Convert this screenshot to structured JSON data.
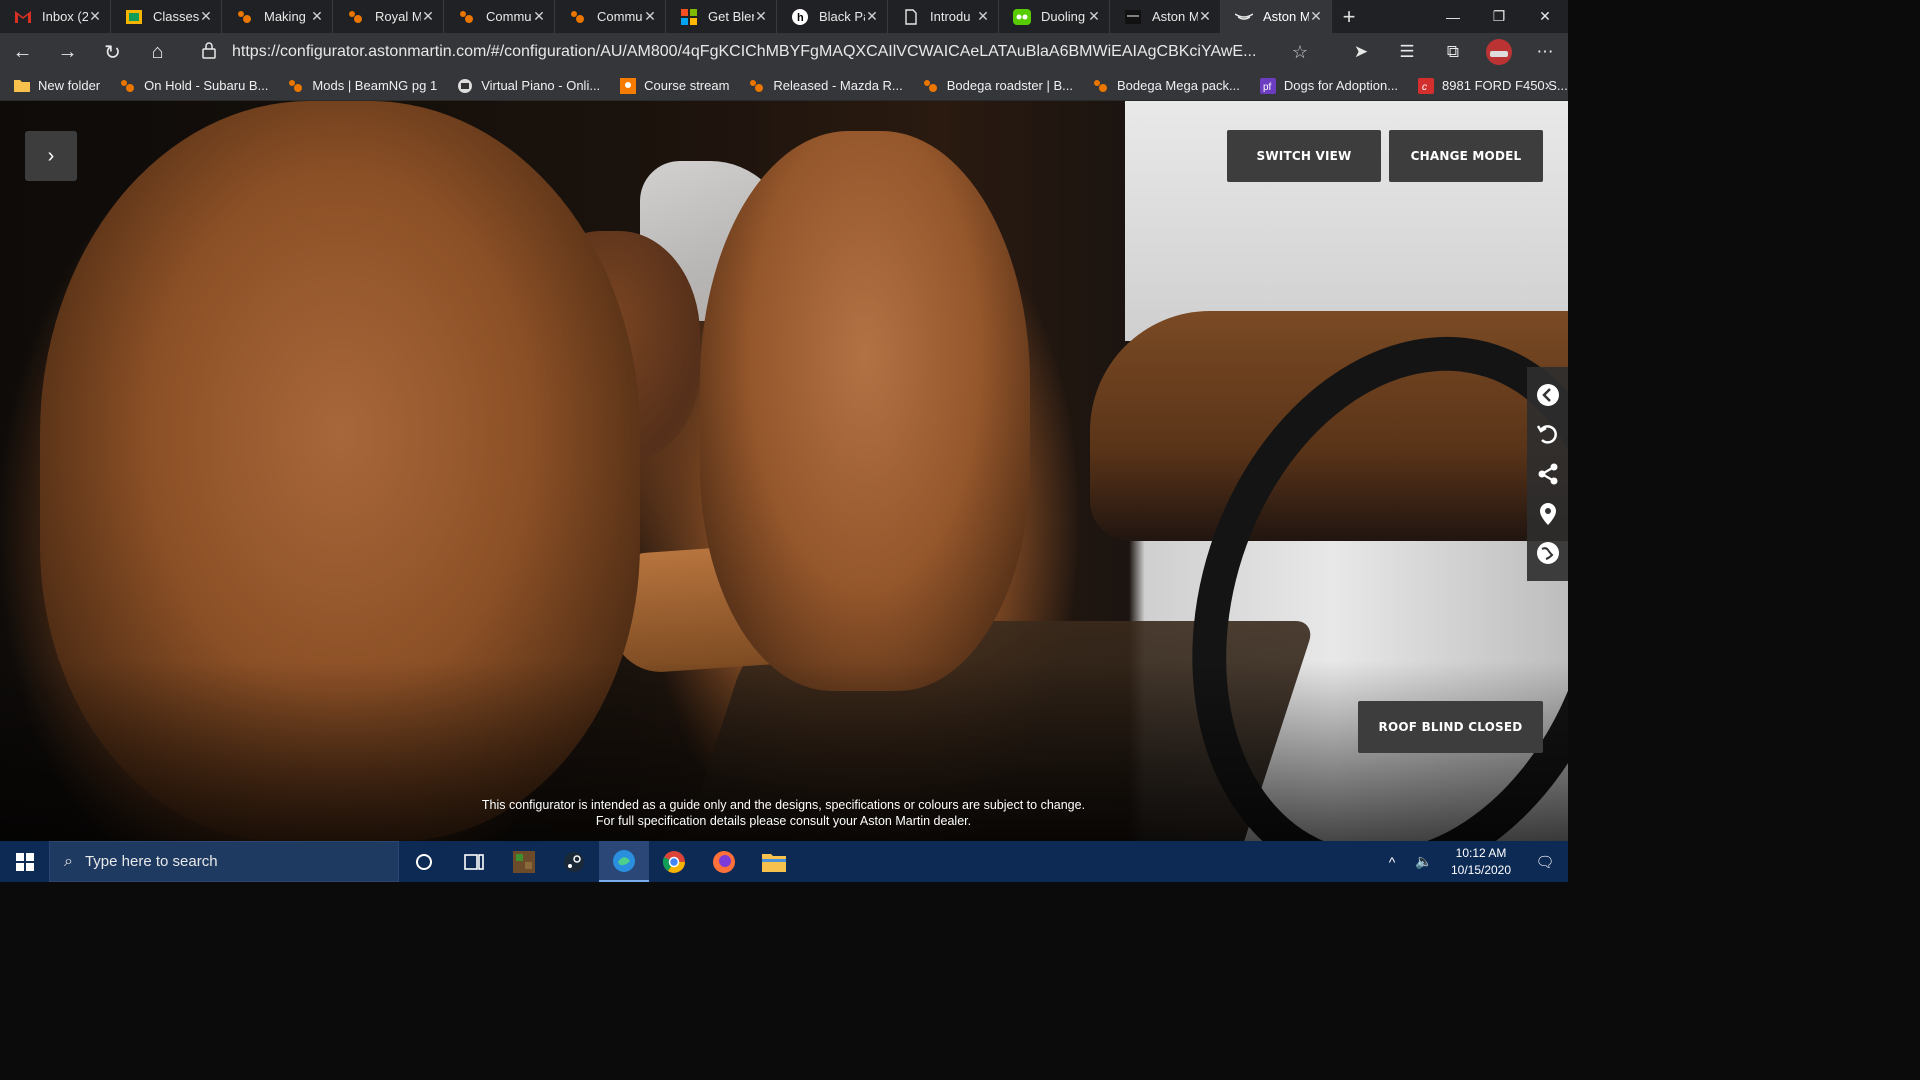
{
  "browser": {
    "tabs": [
      {
        "title": "Inbox (2",
        "icon": "gmail-icon",
        "color": "#d93025"
      },
      {
        "title": "Classes",
        "icon": "classroom-icon",
        "color": "#f4b400"
      },
      {
        "title": "Making",
        "icon": "blender-icon",
        "color": "#ea7600"
      },
      {
        "title": "Royal M",
        "icon": "blender-icon",
        "color": "#ea7600"
      },
      {
        "title": "Commu",
        "icon": "blender-icon",
        "color": "#ea7600"
      },
      {
        "title": "Commu",
        "icon": "blender-icon",
        "color": "#ea7600"
      },
      {
        "title": "Get Blen",
        "icon": "microsoft-icon",
        "color": "#00a4ef"
      },
      {
        "title": "Black Pa",
        "icon": "h-icon",
        "color": "#ffffff"
      },
      {
        "title": "Introdu",
        "icon": "document-icon",
        "color": "#e8e8e8"
      },
      {
        "title": "Duoling",
        "icon": "duolingo-icon",
        "color": "#58cc02"
      },
      {
        "title": "Aston M",
        "icon": "aston-martin-icon",
        "color": "#111111"
      },
      {
        "title": "Aston M",
        "icon": "aston-martin-icon",
        "color": "#ffffff",
        "active": true
      }
    ],
    "url": "https://configurator.astonmartin.com/#/configuration/AU/AM800/4qFgKCIChMBYFgMAQXCAIlVCWAICAeLATAuBlaA6BMWiEAIAgCBKciYAwE...",
    "bookmarks": [
      {
        "label": "New folder",
        "icon": "folder-icon"
      },
      {
        "label": "On Hold - Subaru B...",
        "icon": "blender-icon"
      },
      {
        "label": "Mods | BeamNG pg 1",
        "icon": "blender-icon"
      },
      {
        "label": "Virtual Piano - Onli...",
        "icon": "piano-icon"
      },
      {
        "label": "Course stream",
        "icon": "classroom-icon"
      },
      {
        "label": "Released - Mazda R...",
        "icon": "blender-icon"
      },
      {
        "label": "Bodega roadster | B...",
        "icon": "blender-icon"
      },
      {
        "label": "Bodega Mega pack...",
        "icon": "blender-icon"
      },
      {
        "label": "Dogs for Adoption...",
        "icon": "petfinder-icon"
      },
      {
        "label": "8981 FORD F450 S...",
        "icon": "ford-icon"
      }
    ]
  },
  "configurator": {
    "switch_view": "SWITCH VIEW",
    "change_model": "CHANGE MODEL",
    "roof_blind": "ROOF BLIND CLOSED",
    "disclaimer_line1": "This configurator is intended as a guide only and the designs, specifications or colours are subject to change.",
    "disclaimer_line2": "For full specification details please consult your Aston Martin dealer.",
    "side_tools": [
      "chevron-left-icon",
      "undo-icon",
      "share-icon",
      "location-pin-icon",
      "globe-icon"
    ]
  },
  "taskbar": {
    "search_placeholder": "Type here to search",
    "time": "10:12 AM",
    "date": "10/15/2020"
  }
}
